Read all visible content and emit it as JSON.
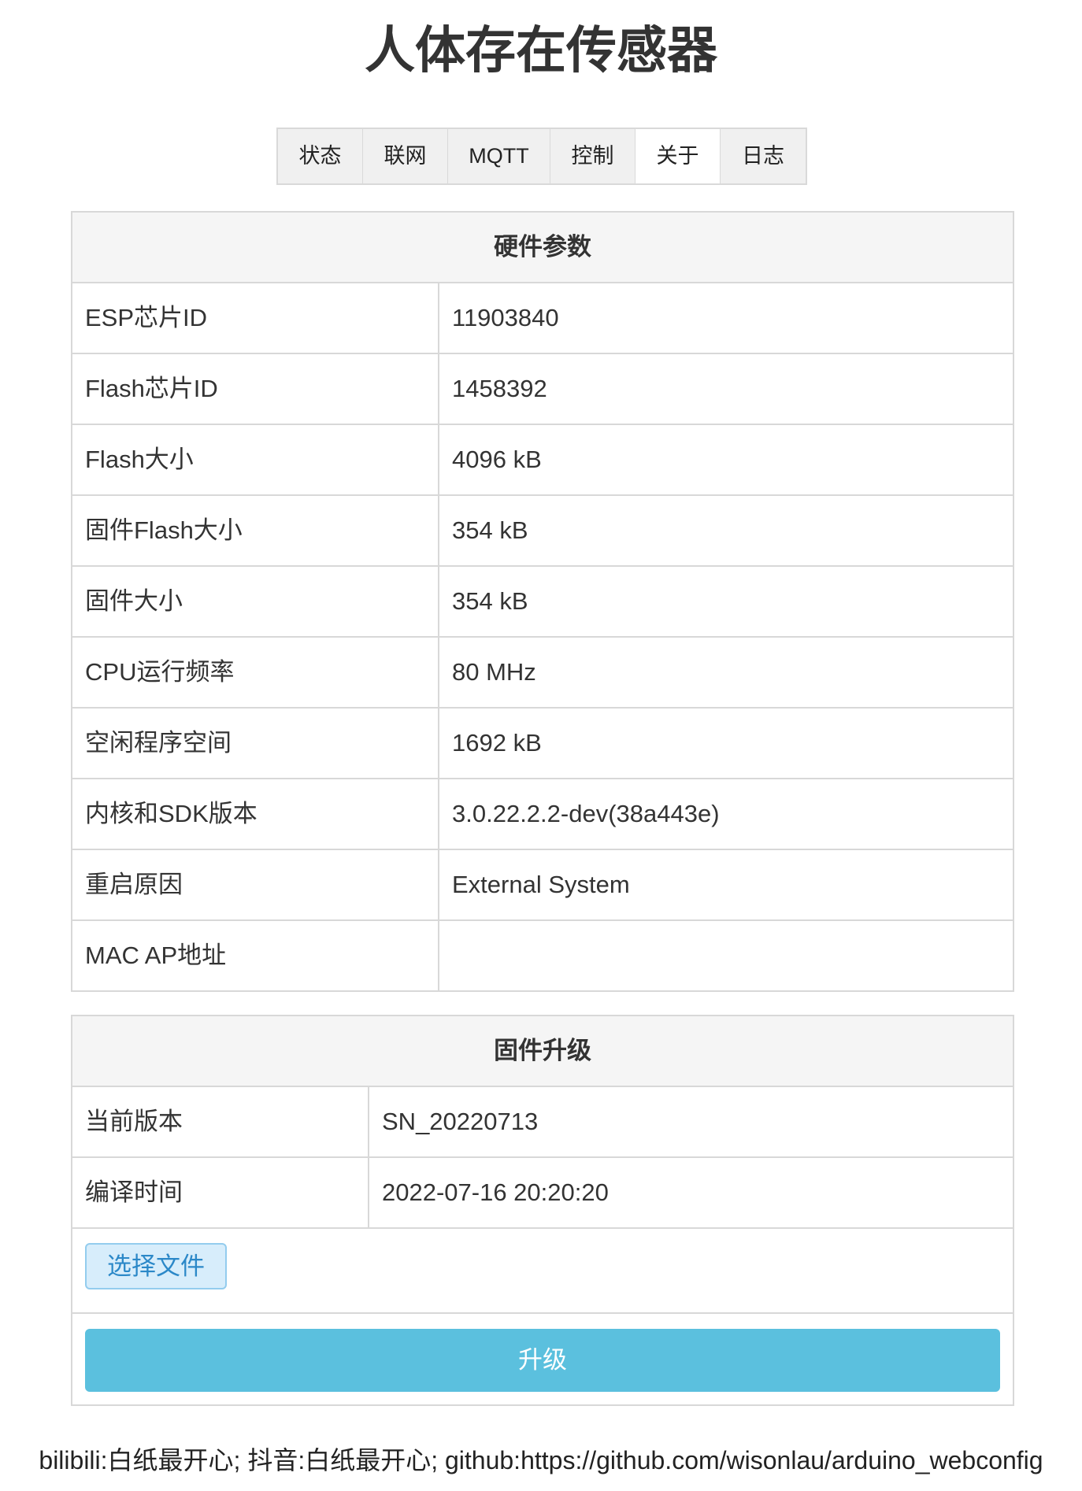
{
  "page": {
    "title": "人体存在传感器"
  },
  "tabs": [
    {
      "label": "状态",
      "active": false
    },
    {
      "label": "联网",
      "active": false
    },
    {
      "label": "MQTT",
      "active": false
    },
    {
      "label": "控制",
      "active": false
    },
    {
      "label": "关于",
      "active": true
    },
    {
      "label": "日志",
      "active": false
    }
  ],
  "hardware": {
    "heading": "硬件参数",
    "rows": [
      {
        "label": "ESP芯片ID",
        "value": "11903840"
      },
      {
        "label": "Flash芯片ID",
        "value": "1458392"
      },
      {
        "label": "Flash大小",
        "value": "4096 kB"
      },
      {
        "label": "固件Flash大小",
        "value": "354 kB"
      },
      {
        "label": "固件大小",
        "value": "354 kB"
      },
      {
        "label": "CPU运行频率",
        "value": "80 MHz"
      },
      {
        "label": "空闲程序空间",
        "value": "1692 kB"
      },
      {
        "label": "内核和SDK版本",
        "value": "3.0.22.2.2-dev(38a443e)"
      },
      {
        "label": "重启原因",
        "value": "External System"
      },
      {
        "label": "MAC AP地址",
        "value": ""
      }
    ]
  },
  "firmware": {
    "heading": "固件升级",
    "rows": [
      {
        "label": "当前版本",
        "value": "SN_20220713"
      },
      {
        "label": "编译时间",
        "value": "2022-07-16 20:20:20"
      }
    ],
    "file_button_label": "选择文件",
    "upgrade_button_label": "升级"
  },
  "footer": {
    "text": "bilibili:白纸最开心; 抖音:白纸最开心; github:https://github.com/wisonlau/arduino_webconfig"
  },
  "colors": {
    "upgrade_button": "#5bc0de",
    "file_button_bg": "#d7edfb",
    "file_button_text": "#2b88c8",
    "tab_bg": "#f0f0f0",
    "active_tab_bg": "#ffffff",
    "table_header_bg": "#f5f5f5",
    "border": "#d8d8d8"
  }
}
